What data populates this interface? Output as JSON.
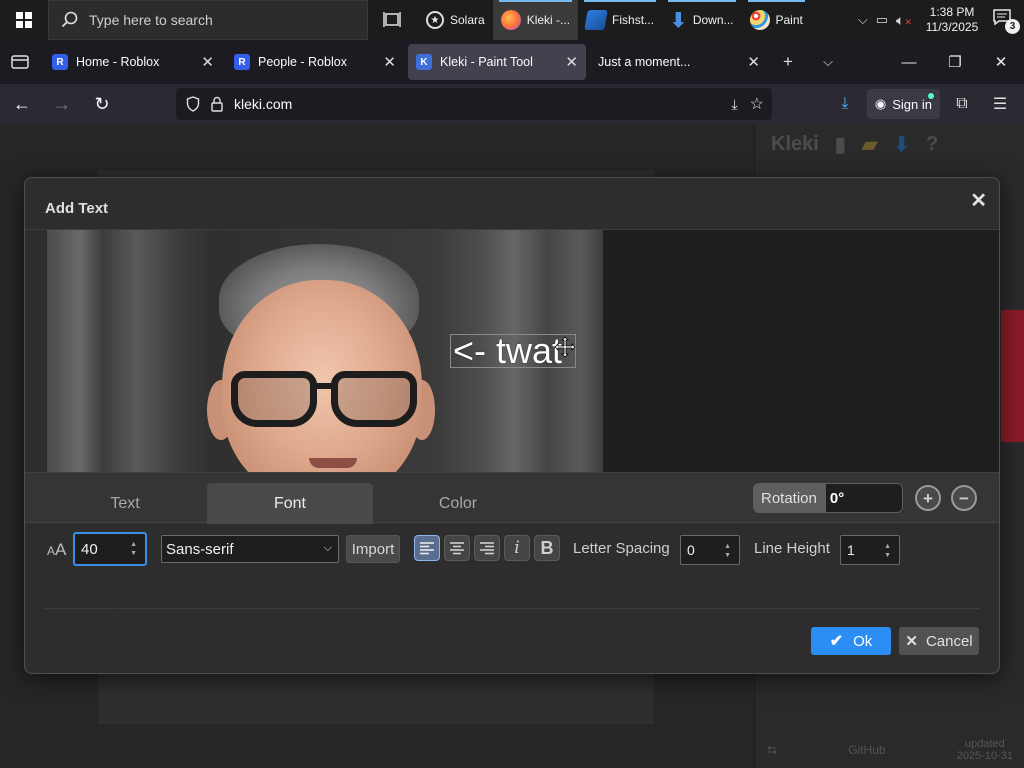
{
  "taskbar": {
    "search_placeholder": "Type here to search",
    "apps": [
      {
        "label": "Solara",
        "color": "#1c1c1c"
      },
      {
        "label": "Kleki -...",
        "color": "#ff7139"
      },
      {
        "label": "Fishst...",
        "color": "#1e88e5"
      },
      {
        "label": "Down...",
        "color": "#4a90e2"
      },
      {
        "label": "Paint",
        "color": "#f5b041"
      }
    ],
    "time": "1:38 PM",
    "date": "11/3/2025",
    "notification_count": "3"
  },
  "browser": {
    "tabs": [
      {
        "title": "Home - Roblox",
        "favicon": "R"
      },
      {
        "title": "People - Roblox",
        "favicon": "R"
      },
      {
        "title": "Kleki - Paint Tool",
        "favicon": "K"
      },
      {
        "title": "Just a moment...",
        "favicon": ""
      }
    ],
    "url": "kleki.com",
    "sign_in": "Sign in"
  },
  "kleki": {
    "logo": "Kleki",
    "footer_left": "GitHub",
    "footer_right_1": "updated",
    "footer_right_2": "2025-10-31"
  },
  "dialog": {
    "title": "Add Text",
    "overlay_text": "<- twat",
    "tabs": [
      "Text",
      "Font",
      "Color"
    ],
    "active_tab": "Font",
    "rotation_label": "Rotation",
    "rotation_value": "0°",
    "font_size": "40",
    "font_family": "Sans-serif",
    "import_label": "Import",
    "letter_spacing_label": "Letter Spacing",
    "letter_spacing_value": "0",
    "line_height_label": "Line Height",
    "line_height_value": "1",
    "ok_label": "Ok",
    "cancel_label": "Cancel",
    "accent": "#2a8ef5"
  }
}
